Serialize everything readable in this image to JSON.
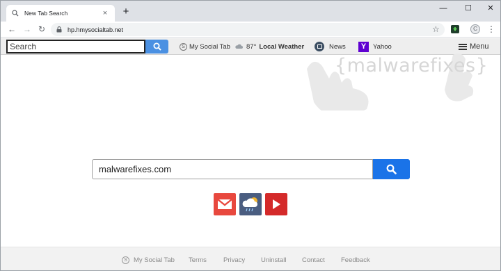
{
  "browser": {
    "tab_title": "New Tab Search",
    "tab_close": "×",
    "new_tab": "+",
    "url": "hp.hmysocialtab.net",
    "profile_initial": "C",
    "window_controls": {
      "minimize": "—",
      "maximize": "☐",
      "close": "✕"
    }
  },
  "extension_bar": {
    "search_placeholder": "Search",
    "social_tab": "My Social Tab",
    "social_icon_letter": "S",
    "weather_temp": "87°",
    "weather_label": "Local Weather",
    "news_label": "News",
    "yahoo_icon_letter": "Y",
    "yahoo_label": "Yahoo",
    "menu_label": "Menu"
  },
  "watermark": {
    "text": "{malwarefixes}"
  },
  "main": {
    "search_value": "malwarefixes.com",
    "shortcuts": [
      {
        "name": "gmail",
        "icon": "gmail-icon",
        "color": "#e8483e"
      },
      {
        "name": "weather",
        "icon": "weather-icon",
        "color": "#4a5d80"
      },
      {
        "name": "youtube",
        "icon": "youtube-icon",
        "color": "#d42a2a"
      }
    ]
  },
  "footer": {
    "social_icon_letter": "S",
    "links": [
      "My Social Tab",
      "Terms",
      "Privacy",
      "Uninstall",
      "Contact",
      "Feedback"
    ]
  },
  "colors": {
    "search_button": "#1a73e8",
    "ext_search_button": "#4a90e2",
    "yahoo": "#5f01d1",
    "toolbar_bg": "#eeeeee"
  }
}
